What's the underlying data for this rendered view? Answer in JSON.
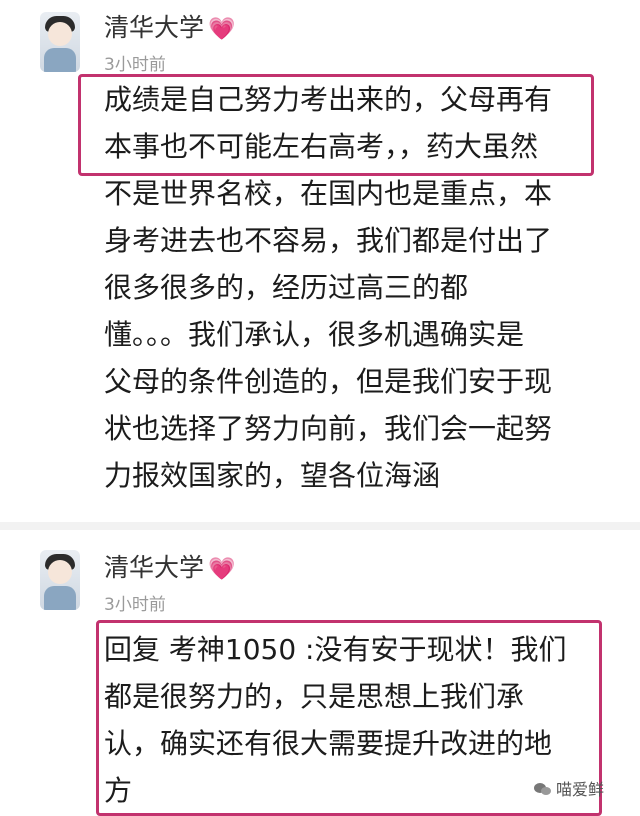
{
  "comments": [
    {
      "username": "清华大学",
      "heart_icon": "heart-icon",
      "time": "3小时前",
      "text": "成绩是自己努力考出来的，父母再有\n本事也不可能左右高考，，药大虽然\n不是世界名校，在国内也是重点，本\n身考进去也不容易，我们都是付出了\n很多很多的，经历过高三的都\n懂。。。我们承认，很多机遇确实是\n父母的条件创造的，但是我们安于现\n状也选择了努力向前，我们会一起努\n力报效国家的，望各位海涵"
    },
    {
      "username": "清华大学",
      "heart_icon": "heart-icon",
      "time": "3小时前",
      "text": "回复 考神1050 :没有安于现状！我们\n都是很努力的，只是思想上我们承\n认，确实还有很大需要提升改进的地\n方"
    }
  ],
  "watermark": {
    "icon": "wechat-icon",
    "text": "喵爱鲜"
  },
  "colors": {
    "highlight_box": "#c2326e",
    "username": "#333333",
    "time": "#9a9a9a"
  }
}
